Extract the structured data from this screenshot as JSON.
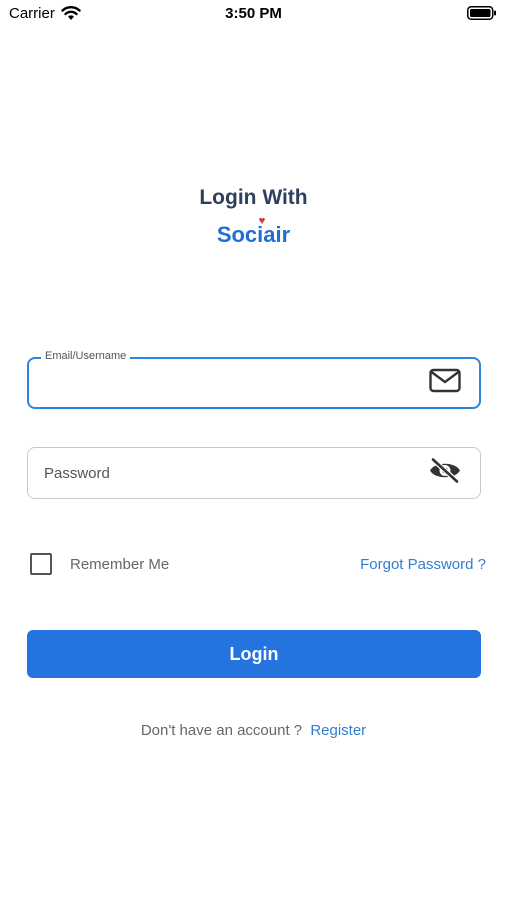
{
  "status_bar": {
    "carrier": "Carrier",
    "time": "3:50 PM"
  },
  "header": {
    "title": "Login With",
    "brand": "Sociair"
  },
  "email_field": {
    "label": "Email/Username",
    "value": "",
    "icon": "mail-icon"
  },
  "password_field": {
    "placeholder": "Password",
    "value": "",
    "icon": "eye-off-icon"
  },
  "remember_me": {
    "label": "Remember Me",
    "checked": false
  },
  "forgot_password": {
    "label": "Forgot Password ?"
  },
  "login_button": {
    "label": "Login"
  },
  "register": {
    "prompt": "Don't have an account ?",
    "link_label": "Register"
  },
  "colors": {
    "accent": "#2473df",
    "link": "#2f7fd0",
    "title": "#2f3f5e",
    "border_active": "#2c86e0"
  }
}
